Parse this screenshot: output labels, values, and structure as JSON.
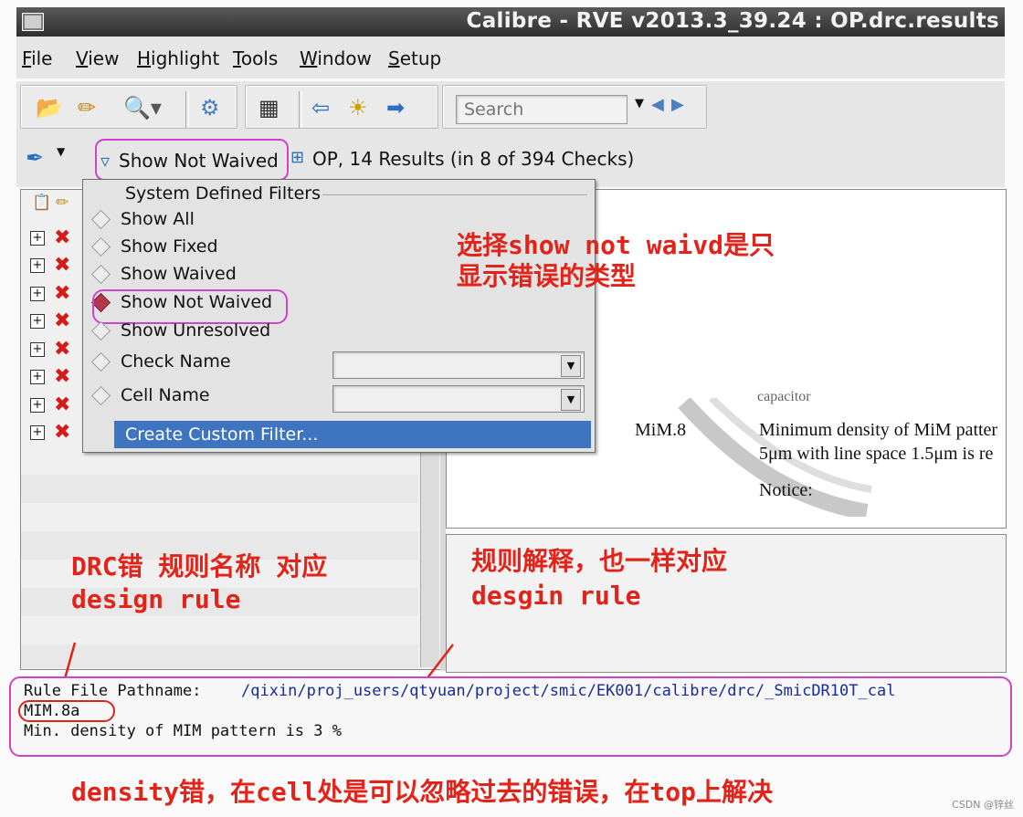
{
  "window": {
    "title": "Calibre - RVE v2013.3_39.24 : OP.drc.results"
  },
  "menubar": {
    "items": [
      "File",
      "View",
      "Highlight",
      "Tools",
      "Window",
      "Setup"
    ]
  },
  "toolbar": {
    "search_placeholder": "Search"
  },
  "filter_bar": {
    "filter_label": "Show Not Waived",
    "results_summary": "OP, 14 Results (in 8 of 394 Checks)"
  },
  "filter_menu": {
    "section_title": "System Defined Filters",
    "options": [
      "Show All",
      "Show Fixed",
      "Show Waived",
      "Show Not Waived",
      "Show Unresolved"
    ],
    "selected": "Show Not Waived",
    "check_name_label": "Check Name",
    "cell_name_label": "Cell Name",
    "custom_filter_label": "Create Custom Filter..."
  },
  "results_list": {
    "row_count": 8
  },
  "document_snippet": {
    "partial_top": "capacitor",
    "rule": "MiM.8",
    "desc_line1": "Minimum density of MiM patter",
    "desc_line2": "5μm with line space 1.5μm is re",
    "notice": "Notice:"
  },
  "info_pane": {
    "pathname_label": "Rule File Pathname:",
    "pathname_value": "/qixin/proj_users/qtyuan/project/smic/EK001/calibre/drc/_SmicDR10T_cal",
    "rule_name": "MIM.8a",
    "rule_desc": "Min. density of MIM pattern is 3 %"
  },
  "annotations": {
    "filter_note_line1": "选择show not waivd是只",
    "filter_note_line2": "显示错误的类型",
    "left_note_line1": "DRC错 规则名称 对应",
    "left_note_line2": "design rule",
    "right_note_line1": "规则解释，也一样对应",
    "right_note_line2": "desgin rule",
    "footer_note": "density错，在cell处是可以忽略过去的错误，在top上解决"
  },
  "watermark": "CSDN @锌丝",
  "colors": {
    "annotation": "#e2231a",
    "highlight_ring": "#cc44cc",
    "selection": "#3f74c1"
  }
}
